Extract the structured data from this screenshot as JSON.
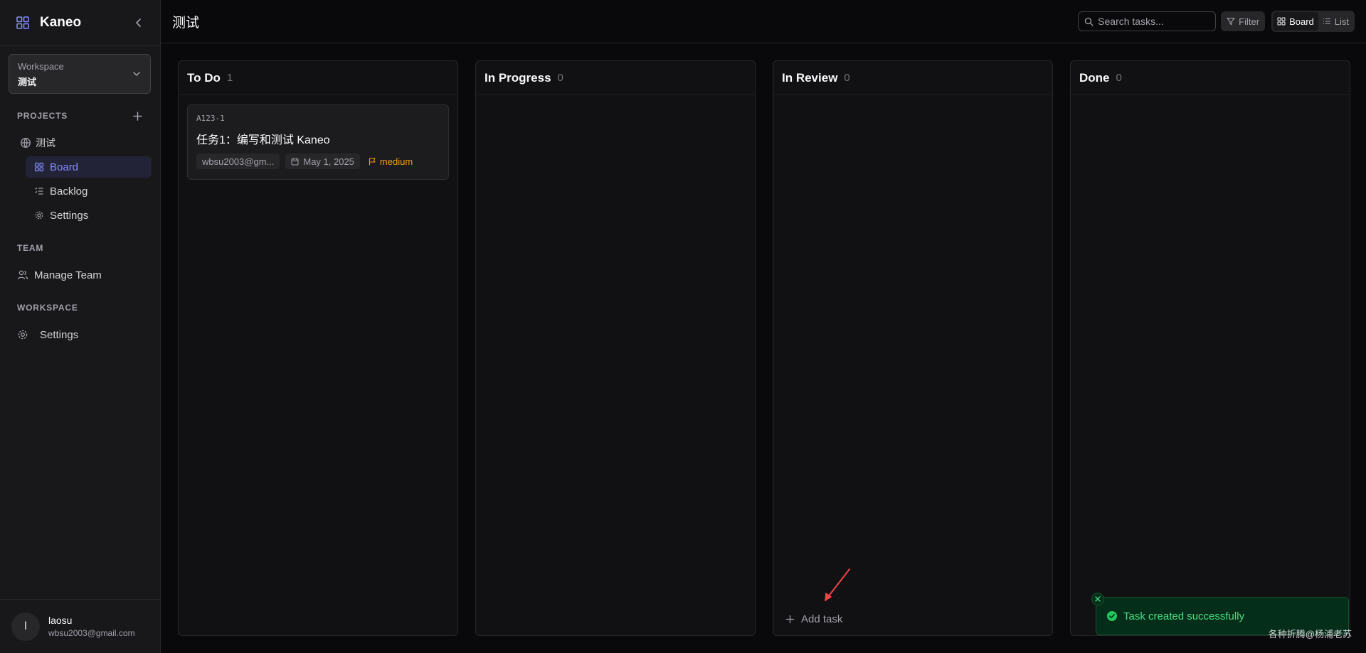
{
  "sidebar": {
    "brand": "Kaneo",
    "workspace_label": "Workspace",
    "workspace_name": "测试",
    "projects_title": "PROJECTS",
    "project_name": "测试",
    "project_items": [
      {
        "label": "Board",
        "icon": "board-icon",
        "active": true
      },
      {
        "label": "Backlog",
        "icon": "backlog-icon",
        "active": false
      },
      {
        "label": "Settings",
        "icon": "gear-icon",
        "active": false
      }
    ],
    "team_title": "TEAM",
    "manage_team": "Manage Team",
    "workspace_title": "WORKSPACE",
    "workspace_settings": "Settings",
    "user": {
      "initial": "l",
      "name": "laosu",
      "email": "wbsu2003@gmail.com"
    }
  },
  "header": {
    "title": "测试",
    "search_placeholder": "Search tasks...",
    "filter_label": "Filter",
    "view_board": "Board",
    "view_list": "List"
  },
  "columns": [
    {
      "title": "To Do",
      "count": "1"
    },
    {
      "title": "In Progress",
      "count": "0"
    },
    {
      "title": "In Review",
      "count": "0",
      "add_task": "Add task"
    },
    {
      "title": "Done",
      "count": "0"
    }
  ],
  "task": {
    "id": "A123-1",
    "title": "任务1：编写和测试 Kaneo",
    "assignee": "wbsu2003@gm...",
    "due": "May 1, 2025",
    "priority": "medium"
  },
  "toast": {
    "text": "Task created successfully"
  },
  "watermark": "各种折腾@杨浦老苏",
  "colors": {
    "accent": "#818cf8",
    "priority_medium": "#f59e0b",
    "success": "#4ade80",
    "arrow": "#ef4444"
  }
}
